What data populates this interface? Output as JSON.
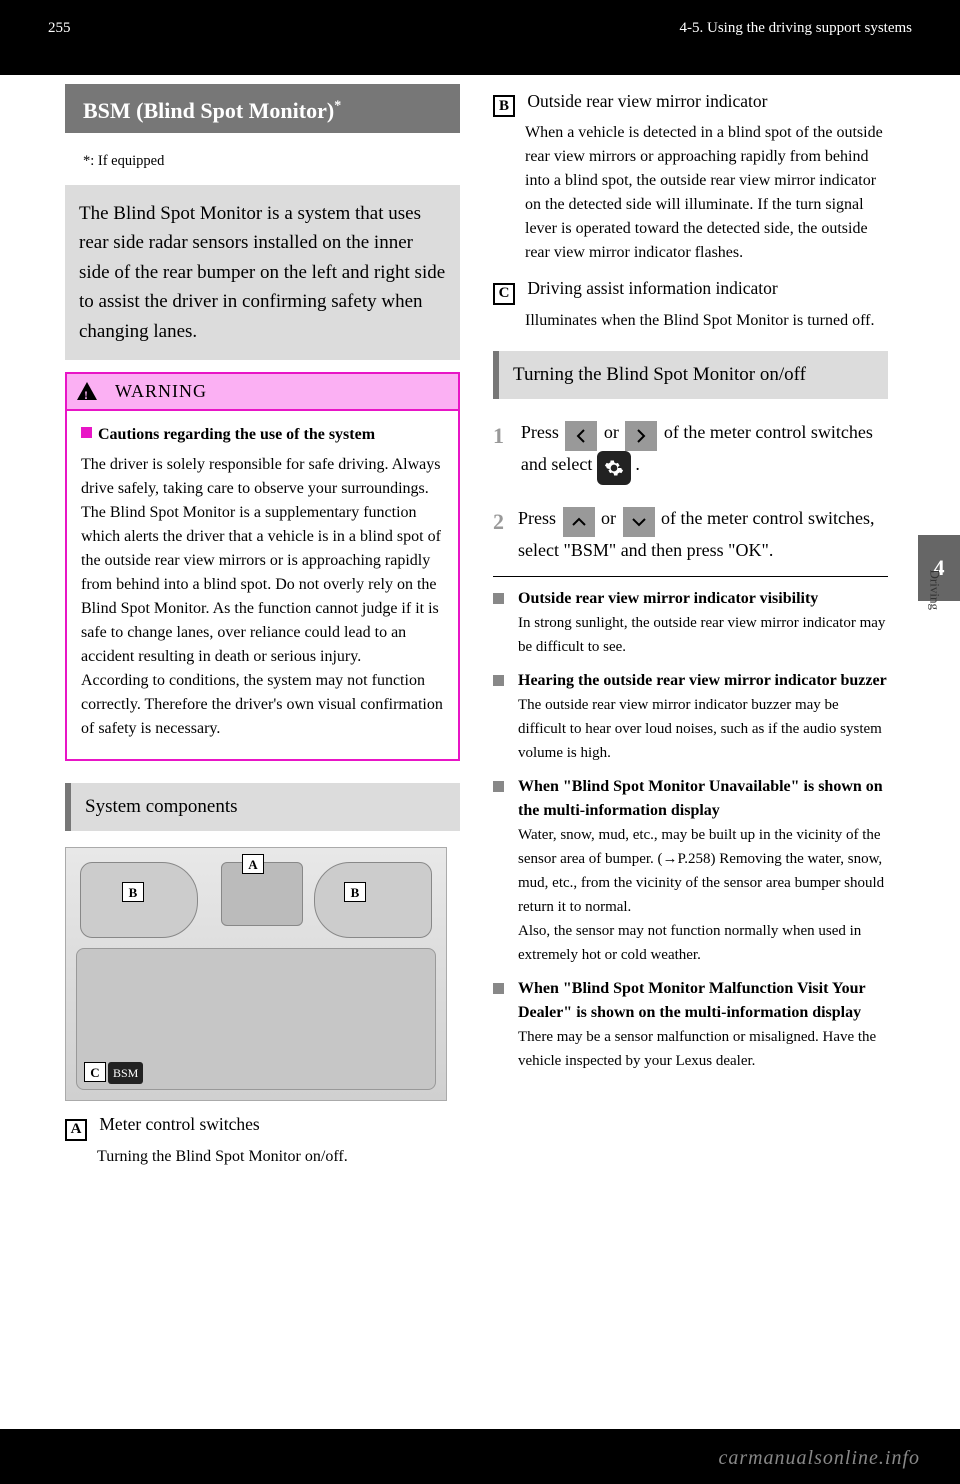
{
  "page_number": "255",
  "header_section": "4-5. Using the driving support systems",
  "thumb_number": "4",
  "thumb_label": "Driving",
  "title": "BSM (Blind Spot Monitor)",
  "title_sup": "*",
  "subtitle": "*: If equipped",
  "intro": "The Blind Spot Monitor is a system that uses rear side radar sensors installed on the inner side of the rear bumper on the left and right side to assist the driver in confirming safety when changing lanes.",
  "warning_label": "WARNING",
  "warning_heading": "Cautions regarding the use of the system",
  "warning_body": "The driver is solely responsible for safe driving. Always drive safely, taking care to observe your surroundings.\nThe Blind Spot Monitor is a supplementary function which alerts the driver that a vehicle is in a blind spot of the outside rear view mirrors or is approaching rapidly from behind into a blind spot. Do not overly rely on the Blind Spot Monitor. As the function cannot judge if it is safe to change lanes, over reliance could lead to an accident resulting in death or serious injury.\nAccording to conditions, the system may not function correctly. Therefore the driver's own visual confirmation of safety is necessary.",
  "section_components": "System components",
  "label_A": "A",
  "label_B": "B",
  "label_C": "C",
  "item_A": "Meter control switches",
  "item_A_sub": "Turning the Blind Spot Monitor on/off.",
  "item_B": "Outside rear view mirror indicator",
  "item_B_sub1": "When a vehicle is detected in a blind spot of the outside rear view mirrors or approaching rapidly from behind into a blind spot, the outside rear view mirror indicator on the detected side will illuminate. If the turn signal lever is operated toward the detected side, the outside rear view mirror indicator flashes.",
  "item_C": "Driving assist information indicator",
  "item_C_sub": "Illuminates when the Blind Spot Monitor is turned off.",
  "section_turn": "Turning the Blind Spot Monitor on/off",
  "step1a": "Press",
  "step1b": "or",
  "step1c": "of the meter control switches and select",
  "step1d": ".",
  "step2a": "Press",
  "step2b": "or",
  "step2c": "of the meter control switches, select \"BSM\" and then press \"OK\".",
  "note1_h": "Outside rear view mirror indicator visibility",
  "note1_b": "In strong sunlight, the outside rear view mirror indicator may be difficult to see.",
  "note2_h": "Hearing the outside rear view mirror indicator buzzer",
  "note2_b": "The outside rear view mirror indicator buzzer may be difficult to hear over loud noises, such as if the audio system volume is high.",
  "note3_h": "When \"Blind Spot Monitor Unavailable\" is shown on the multi-information display",
  "note3_b": "Water, snow, mud, etc., may be built up in the vicinity of the sensor area of bumper. (→P.258) Removing the water, snow, mud, etc., from the vicinity of the sensor area bumper should return it to normal.",
  "note3_b2": "Also, the sensor may not function normally when used in extremely hot or cold weather.",
  "note4_h": "When \"Blind Spot Monitor Malfunction Visit Your Dealer\" is shown on the multi-information display",
  "note4_b": "There may be a sensor malfunction or misaligned. Have the vehicle inspected by your Lexus dealer.",
  "footer_url": "carmanualsonline.info",
  "bsm_label": "BSM"
}
